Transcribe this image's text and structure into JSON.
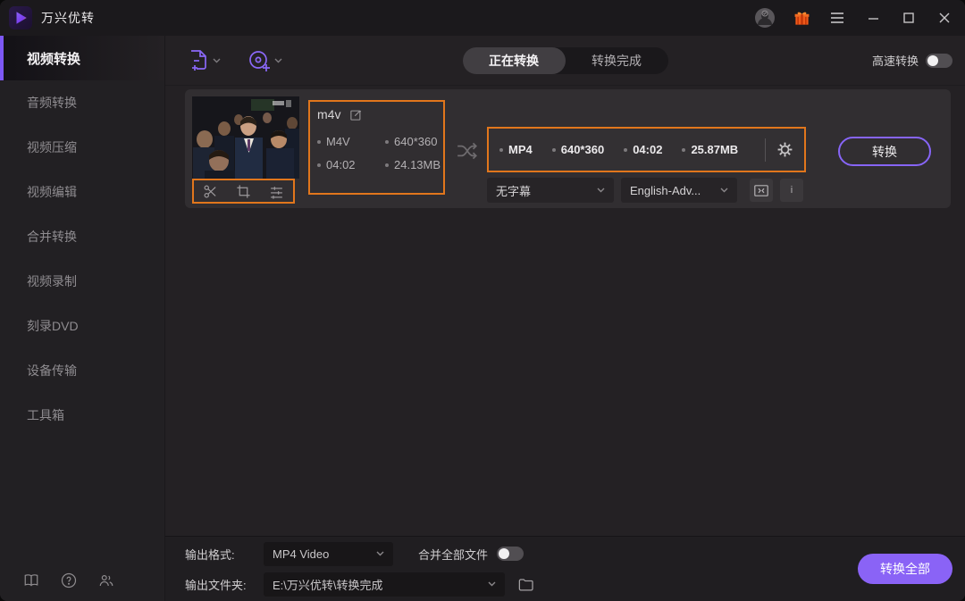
{
  "titlebar": {
    "title": "万兴优转"
  },
  "sidebar": {
    "items": [
      {
        "label": "视频转换",
        "active": true
      },
      {
        "label": "音频转换",
        "active": false
      },
      {
        "label": "视频压缩",
        "active": false
      },
      {
        "label": "视频编辑",
        "active": false
      },
      {
        "label": "合并转换",
        "active": false
      },
      {
        "label": "视频录制",
        "active": false
      },
      {
        "label": "刻录DVD",
        "active": false
      },
      {
        "label": "设备传输",
        "active": false
      },
      {
        "label": "工具箱",
        "active": false
      }
    ]
  },
  "toolbar": {
    "tabs": [
      {
        "label": "正在转换",
        "active": true
      },
      {
        "label": "转换完成",
        "active": false
      }
    ],
    "high_speed_label": "高速转换",
    "high_speed_on": false
  },
  "file_card": {
    "name": "m4v",
    "source": {
      "format": "M4V",
      "resolution": "640*360",
      "duration": "04:02",
      "size": "24.13MB"
    },
    "target": {
      "format": "MP4",
      "resolution": "640*360",
      "duration": "04:02",
      "size": "25.87MB"
    },
    "subtitle_selected": "无字幕",
    "audio_selected": "English-Adv...",
    "subtitle_btn_glyph": "><",
    "info_btn_glyph": "i",
    "convert_label": "转换"
  },
  "footer": {
    "output_format_label": "输出格式:",
    "output_format_value": "MP4 Video",
    "merge_label": "合并全部文件",
    "merge_on": false,
    "output_folder_label": "输出文件夹:",
    "output_folder_value": "E:\\万兴优转\\转换完成",
    "convert_all_label": "转换全部"
  },
  "colors": {
    "accent_purple": "#8a63f6",
    "highlight_orange": "#e1761c",
    "gift_orange": "#f05a1a"
  }
}
